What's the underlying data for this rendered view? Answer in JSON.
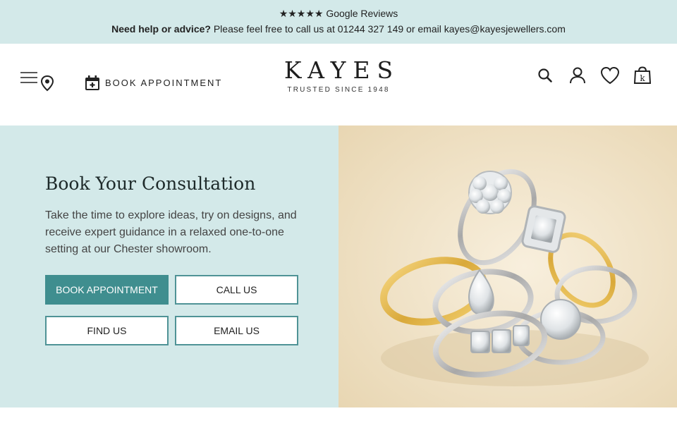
{
  "topbar": {
    "reviews": "★★★★★ Google Reviews",
    "help_bold": "Need help or advice?",
    "help_text": " Please feel free to call us at 01244 327 149 or email kayes@kayesjewellers.com"
  },
  "header": {
    "book_label": "BOOK APPOINTMENT",
    "logo_text": "KAYES",
    "logo_tagline": "TRUSTED SINCE 1948",
    "icons": [
      "menu-icon",
      "location-pin-icon",
      "calendar-add-icon",
      "search-icon",
      "account-icon",
      "heart-icon",
      "shopping-bag-icon"
    ]
  },
  "hero": {
    "title": "Book Your Consultation",
    "text": "Take the time to explore ideas, try on designs, and receive expert guidance in a relaxed one-to-one setting at our Chester showroom.",
    "buttons": {
      "book": "BOOK APPOINTMENT",
      "call": "CALL US",
      "find": "FIND US",
      "email": "EMAIL US"
    },
    "image_alt": "Engagement rings on a beige background"
  },
  "colors": {
    "accent": "#3f8e8f",
    "topbar_bg": "#d3e9e9",
    "hero_bg": "#d3e9e9",
    "image_bg": "#efe2c6"
  }
}
